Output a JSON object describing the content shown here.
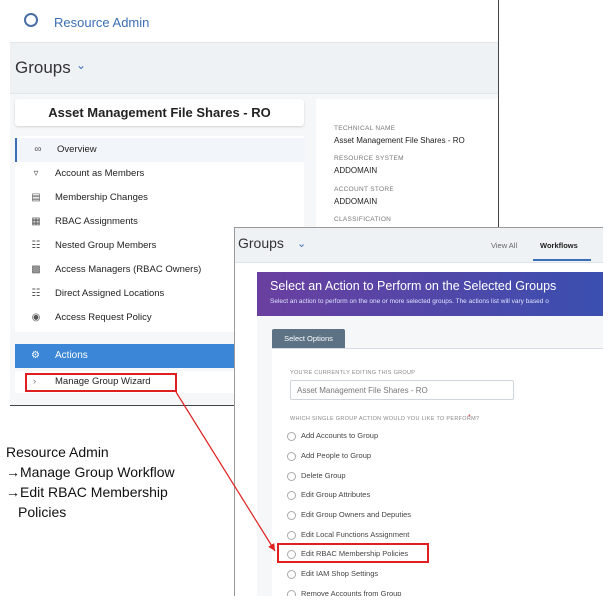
{
  "back": {
    "app_title": "Resource Admin",
    "groups_title": "Groups",
    "group_name": "Asset Management File Shares - RO",
    "menu": [
      {
        "label": "Overview",
        "icon": "glasses-icon"
      },
      {
        "label": "Account as Members",
        "icon": "user-icon"
      },
      {
        "label": "Membership Changes",
        "icon": "changes-icon"
      },
      {
        "label": "RBAC Assignments",
        "icon": "list-icon"
      },
      {
        "label": "Nested Group Members",
        "icon": "nested-icon"
      },
      {
        "label": "Access Managers (RBAC Owners)",
        "icon": "building-icon"
      },
      {
        "label": "Direct Assigned Locations",
        "icon": "location-icon"
      },
      {
        "label": "Access Request Policy",
        "icon": "policy-icon"
      }
    ],
    "actions_label": "Actions",
    "wizard_label": "Manage Group Wizard",
    "details": [
      {
        "label": "TECHNICAL NAME",
        "value": "Asset Management File Shares - RO"
      },
      {
        "label": "RESOURCE SYSTEM",
        "value": "ADDOMAIN"
      },
      {
        "label": "ACCOUNT STORE",
        "value": "ADDOMAIN"
      },
      {
        "label": "CLASSIFICATION",
        "value": ""
      }
    ]
  },
  "front": {
    "groups_title": "Groups",
    "tabs": {
      "view_all": "View All",
      "workflows": "Workflows"
    },
    "banner_title": "Select an Action to Perform on the Selected Groups",
    "banner_sub": "Select an action to perform on the one or more selected groups. The actions list will vary based o",
    "select_tab": "Select Options",
    "editing_label": "YOU'RE CURRENTLY EDITING THIS GROUP",
    "editing_value": "Asset Management File Shares - RO",
    "question": "WHICH SINGLE GROUP ACTION WOULD YOU LIKE TO PERFORM?",
    "required_mark": "*",
    "options": [
      "Add Accounts to Group",
      "Add People to Group",
      "Delete Group",
      "Edit Group Attributes",
      "Edit Group Owners and Deputies",
      "Edit Local Functions Assignment",
      "Edit RBAC Membership Policies",
      "Edit IAM Shop Settings",
      "Remove Accounts from Group"
    ]
  },
  "annotation": {
    "line1": "Resource Admin",
    "line2": "→Manage Group Workflow",
    "line3": "→Edit RBAC Membership",
    "line4": "Policies"
  },
  "colors": {
    "highlight": "#e02020",
    "accent": "#3b86d6",
    "banner_start": "#6a3fa0",
    "banner_end": "#3a4fb0"
  }
}
